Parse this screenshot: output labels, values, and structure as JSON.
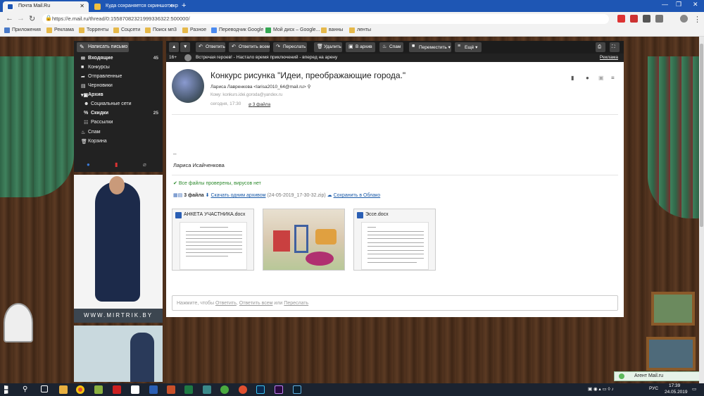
{
  "browser": {
    "tabs": [
      {
        "title": "Почта Mail.Ru",
        "active": true
      },
      {
        "title": "Куда сохраняется скриншот экр",
        "active": false
      }
    ],
    "url": "https://e.mail.ru/thread/0:15587082321999336322:500000/",
    "bookmarks": [
      "Приложения",
      "Реклама",
      "Торренты",
      "Соцсети",
      "Поиск мп3",
      "Разное",
      "Переводчик Google",
      "Мой диск – Google...",
      "ванны",
      "ленты"
    ]
  },
  "sidebar": {
    "compose_label": "Написать письмо",
    "folders": [
      {
        "label": "Входящие",
        "count": "45",
        "icon": "inbox-icon",
        "bold": true,
        "level": 0
      },
      {
        "label": "Конкурсы",
        "count": "",
        "icon": "folder-icon",
        "bold": false,
        "level": 0
      },
      {
        "label": "Отправленные",
        "count": "",
        "icon": "sent-icon",
        "bold": false,
        "level": 0
      },
      {
        "label": "Черновики",
        "count": "",
        "icon": "draft-icon",
        "bold": false,
        "level": 0
      },
      {
        "label": "Архив",
        "count": "",
        "icon": "archive-icon",
        "bold": true,
        "level": 0
      },
      {
        "label": "Социальные сети",
        "count": "",
        "icon": "people-icon",
        "bold": false,
        "level": 1
      },
      {
        "label": "Скидки",
        "count": "25",
        "icon": "percent-icon",
        "bold": true,
        "level": 1
      },
      {
        "label": "Рассылки",
        "count": "",
        "icon": "newsletter-icon",
        "bold": false,
        "level": 1
      },
      {
        "label": "Спам",
        "count": "",
        "icon": "spam-icon",
        "bold": false,
        "level": 0
      },
      {
        "label": "Корзина",
        "count": "",
        "icon": "trash-icon",
        "bold": false,
        "level": 0
      }
    ]
  },
  "toolbar": {
    "buttons": [
      "Ответить",
      "Ответить всем",
      "Переслать",
      "Удалить",
      "В архив",
      "Спам",
      "Переместить",
      "Ещё"
    ]
  },
  "ticker": {
    "age": "16+",
    "message": "Встречая героев! - Настало время приключений - вперед на арену",
    "ad_label": "Реклама"
  },
  "message": {
    "subject": "Конкурс рисунка \"Идеи, преображающие города.\"",
    "sender": "Лариса Лавренкова <larisa2010_64@mail.ru>",
    "to": "Кому: konkurs.idei.goroda@yandex.ru",
    "time": "сегодня, 17:30",
    "attach_link": "3 файла",
    "sig_dash": "--",
    "sig_name": "Лариса Исайченкова",
    "virus_check": "Все файлы проверены, вирусов нет",
    "files_count": "3 файла",
    "download_link": "Скачать одним архивом",
    "archive_name": "(24-05-2019_17-30-32.zip)",
    "cloud_link": "Сохранить в Облако",
    "attachments": [
      {
        "name": "АНКЕТА УЧАСТНИКА.docx",
        "type": "docx"
      },
      {
        "name": "",
        "type": "image"
      },
      {
        "name": "Эссе.docx",
        "type": "docx"
      }
    ],
    "reply_prompt": "Нажмите, чтобы",
    "reply_opt1": "Ответить",
    "reply_opt2": "Ответить всем",
    "reply_or": "или",
    "reply_opt3": "Переслать"
  },
  "ads": {
    "brand": "WWW.MIRTRIK.BY"
  },
  "agent": {
    "label": "Агент Mail.ru"
  },
  "taskbar": {
    "lang": "РУС",
    "time": "17:39",
    "date": "24.05.2019"
  },
  "colors": {
    "chrome_blue": "#1e56b4",
    "link": "#1a5aa8",
    "ok_green": "#2e8a2e"
  }
}
